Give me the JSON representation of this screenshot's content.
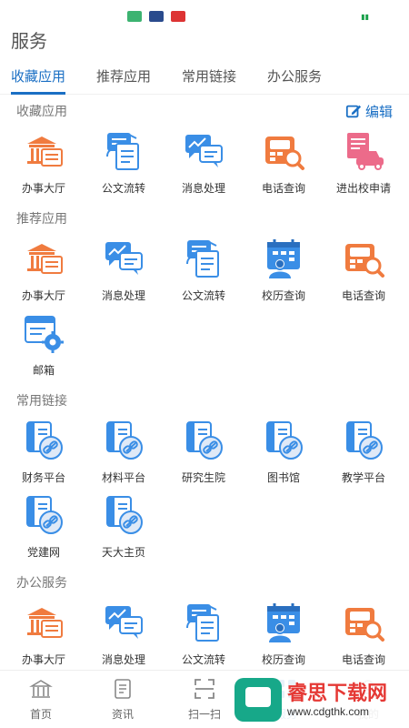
{
  "app": {
    "title": "服务"
  },
  "tabs": [
    {
      "label": "收藏应用",
      "active": true
    },
    {
      "label": "推荐应用",
      "active": false
    },
    {
      "label": "常用链接",
      "active": false
    },
    {
      "label": "办公服务",
      "active": false
    }
  ],
  "edit_label": "编辑",
  "sections": {
    "favorites": {
      "title": "收藏应用",
      "items": [
        {
          "label": "办事大厅",
          "icon": "hall-icon"
        },
        {
          "label": "公文流转",
          "icon": "document-flow-icon"
        },
        {
          "label": "消息处理",
          "icon": "message-icon"
        },
        {
          "label": "电话查询",
          "icon": "phone-icon"
        },
        {
          "label": "进出校申请",
          "icon": "car-icon"
        }
      ]
    },
    "recommended": {
      "title": "推荐应用",
      "items": [
        {
          "label": "办事大厅",
          "icon": "hall-icon"
        },
        {
          "label": "消息处理",
          "icon": "message-icon"
        },
        {
          "label": "公文流转",
          "icon": "document-flow-icon"
        },
        {
          "label": "校历查询",
          "icon": "calendar-icon"
        },
        {
          "label": "电话查询",
          "icon": "phone-icon"
        },
        {
          "label": "邮箱",
          "icon": "mail-settings-icon"
        }
      ]
    },
    "links": {
      "title": "常用链接",
      "items": [
        {
          "label": "财务平台",
          "icon": "link-doc-icon"
        },
        {
          "label": "材料平台",
          "icon": "link-doc-icon"
        },
        {
          "label": "研究生院",
          "icon": "link-doc-icon"
        },
        {
          "label": "图书馆",
          "icon": "link-doc-icon"
        },
        {
          "label": "教学平台",
          "icon": "link-doc-icon"
        },
        {
          "label": "党建网",
          "icon": "link-doc-icon"
        },
        {
          "label": "天大主页",
          "icon": "link-doc-icon"
        }
      ]
    },
    "office": {
      "title": "办公服务",
      "items": [
        {
          "label": "办事大厅",
          "icon": "hall-icon"
        },
        {
          "label": "消息处理",
          "icon": "message-icon"
        },
        {
          "label": "公文流转",
          "icon": "document-flow-icon"
        },
        {
          "label": "校历查询",
          "icon": "calendar-icon"
        },
        {
          "label": "电话查询",
          "icon": "phone-icon"
        }
      ]
    }
  },
  "bottom_nav": [
    {
      "label": "首页",
      "icon": "home-icon",
      "active": false
    },
    {
      "label": "资讯",
      "icon": "news-icon",
      "active": false
    },
    {
      "label": "扫一扫",
      "icon": "scan-icon",
      "active": false
    },
    {
      "label": "服务",
      "icon": "service-icon",
      "active": true
    },
    {
      "label": "我的",
      "icon": "profile-icon",
      "active": false
    }
  ],
  "watermark": {
    "title": "睿思下载网",
    "url": "www.cdgthk.com"
  },
  "colors": {
    "accent": "#1a6fc4",
    "orange": "#f07b3f",
    "blue": "#3a8ee6",
    "pink": "#ec6b8a"
  }
}
